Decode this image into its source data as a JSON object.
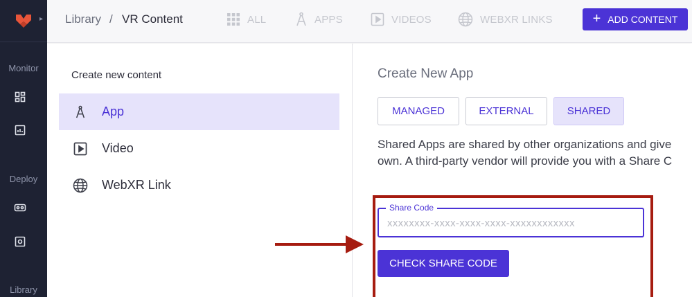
{
  "colors": {
    "accent": "#4b33d6",
    "accent_light": "#e6e3fb",
    "rail_bg": "#1e2233",
    "annotation_red": "#a61c10",
    "logo_orange": "#e8553a"
  },
  "rail": {
    "logo_icon": "brand-logo-icon",
    "sections": [
      {
        "label": "Monitor",
        "icons": [
          "dashboard-icon",
          "report-icon"
        ]
      },
      {
        "label": "Deploy",
        "icons": [
          "vr-headset-icon",
          "settings-box-icon"
        ]
      },
      {
        "label": "Library",
        "icons": []
      }
    ]
  },
  "breadcrumb": {
    "root": "Library",
    "separator": "/",
    "current": "VR Content"
  },
  "filters": [
    {
      "label": "ALL",
      "icon": "grid-icon"
    },
    {
      "label": "APPS",
      "icon": "compass-icon"
    },
    {
      "label": "VIDEOS",
      "icon": "play-box-icon"
    },
    {
      "label": "WEBXR LINKS",
      "icon": "globe-icon"
    }
  ],
  "add_content": {
    "label": "ADD CONTENT",
    "icon": "plus-icon"
  },
  "create_panel": {
    "heading": "Create new content",
    "items": [
      {
        "label": "App",
        "icon": "compass-icon",
        "selected": true
      },
      {
        "label": "Video",
        "icon": "play-box-icon",
        "selected": false
      },
      {
        "label": "WebXR Link",
        "icon": "globe-icon",
        "selected": false
      }
    ]
  },
  "create_app": {
    "title": "Create New App",
    "tabs": [
      {
        "label": "MANAGED",
        "selected": false
      },
      {
        "label": "EXTERNAL",
        "selected": false
      },
      {
        "label": "SHARED",
        "selected": true
      }
    ],
    "description_line1": "Shared Apps are shared by other organizations and give",
    "description_line2": "own. A third-party vendor will provide you with a Share C",
    "share_code": {
      "label": "Share Code",
      "value": "",
      "placeholder": "xxxxxxxx-xxxx-xxxx-xxxx-xxxxxxxxxxxx"
    },
    "check_button": "CHECK SHARE CODE"
  }
}
